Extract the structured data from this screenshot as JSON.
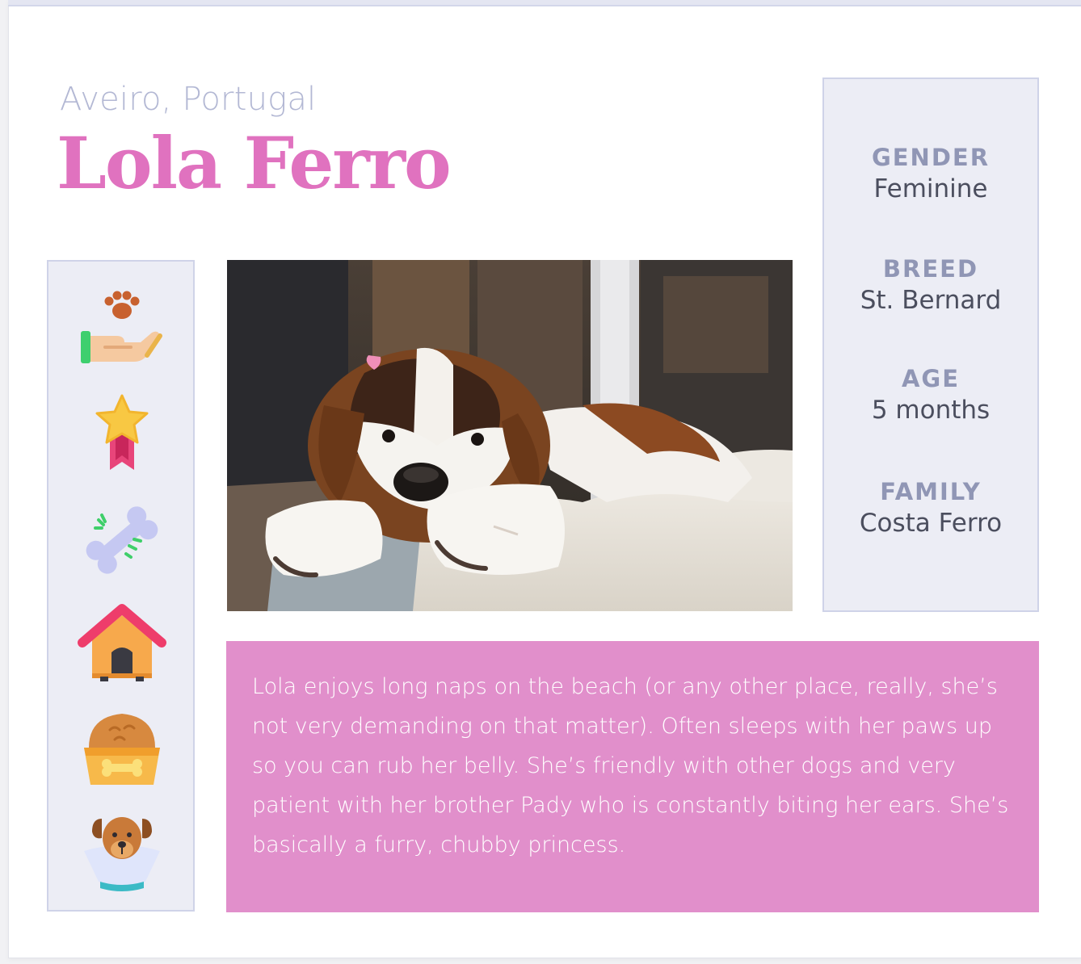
{
  "profile": {
    "location": "Aveiro, Portugal",
    "name": "Lola Ferro"
  },
  "details": {
    "gender": {
      "label": "GENDER",
      "value": "Feminine"
    },
    "breed": {
      "label": "BREED",
      "value": "St. Bernard"
    },
    "age": {
      "label": "AGE",
      "value": "5 months"
    },
    "family": {
      "label": "FAMILY",
      "value": "Costa Ferro"
    }
  },
  "bio": "Lola enjoys long naps on the beach (or any other place, really, she’s not very demanding on that matter). Often sleeps with her paws up so you can rub her belly. She’s friendly with other dogs and very patient with her brother Pady who is constantly biting her ears. She’s basically a furry, chubby princess.",
  "icons": [
    "pet-care-hand-icon",
    "award-ribbon-star-icon",
    "bone-icon",
    "dog-house-icon",
    "pet-food-bowl-icon",
    "dog-with-cone-icon"
  ],
  "colors": {
    "accent_pink": "#e072bf",
    "bio_background": "#e18fcb",
    "panel_background": "#ecedf5",
    "panel_border": "#cfd3e8",
    "label_color": "#9096b5",
    "location_color": "#b3b8d4"
  }
}
